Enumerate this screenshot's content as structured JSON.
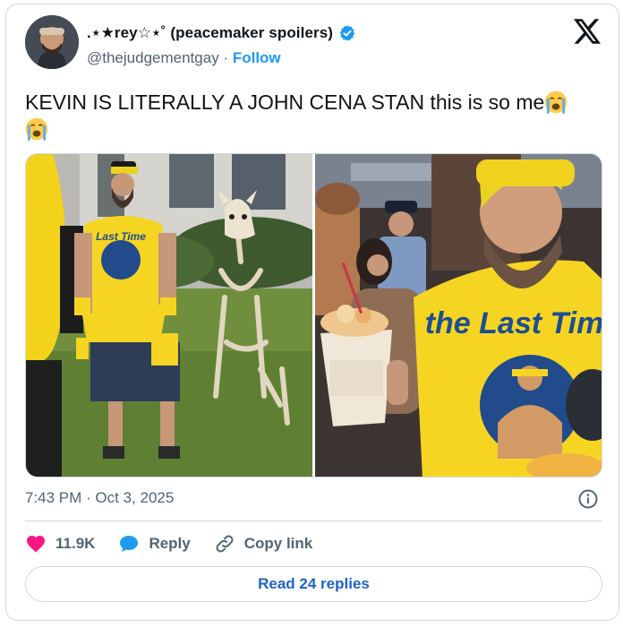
{
  "author": {
    "display_name": ".⋆★rey☆⋆˚ (peacemaker spoilers)",
    "handle": "@thejudgementgay",
    "separator": "·",
    "follow_label": "Follow",
    "verified": true
  },
  "tweet": {
    "text": "KEVIN IS LITERALLY A JOHN CENA STAN this is so me",
    "emoji": "loudly-crying-face",
    "timestamp": "7:43 PM · Oct 3, 2025"
  },
  "actions": {
    "like_count": "11.9K",
    "reply_label": "Reply",
    "copy_link_label": "Copy link"
  },
  "read_replies_label": "Read 24 replies",
  "colors": {
    "accent_blue": "#1d9bf0",
    "like_red": "#f91880",
    "shirt_yellow": "#f5d522",
    "border": "#cfd9de"
  },
  "photos": [
    {
      "print_text": "Last Time"
    },
    {
      "print_text": "the Last Time"
    }
  ]
}
